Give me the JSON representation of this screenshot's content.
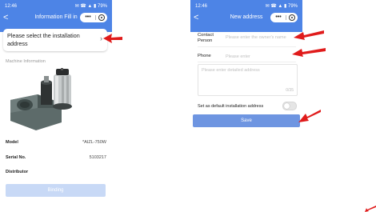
{
  "left": {
    "status": {
      "time": "12:46",
      "icons": "✉ ☎ ▲ ▮ 79%"
    },
    "header": {
      "back": "<",
      "title": "Information Fill in"
    },
    "install_prompt": "Please select the installation address",
    "section_title": "Machine Information",
    "details": [
      {
        "label": "Model",
        "value": "*AIZL-750W"
      },
      {
        "label": "Serial No.",
        "value": "5103217"
      },
      {
        "label": "Distributor",
        "value": ""
      }
    ],
    "bind_button": "Binding"
  },
  "right": {
    "status": {
      "time": "12:46",
      "icons": "✉ ☎ ▲ ▮ 79%"
    },
    "header": {
      "back": "<",
      "title": "New address"
    },
    "contact_label": "Contact Person",
    "contact_placeholder": "Please enter the owner's name",
    "phone_label": "Phone",
    "phone_placeholder": "Please enter",
    "address_placeholder": "Please enter detailed address",
    "address_count": "0/35",
    "default_label": "Set as default installation address",
    "save_button": "Save"
  },
  "colors": {
    "header": "#4d84e6",
    "save": "#6e95e1",
    "bind_disabled": "#c8d9f6",
    "arrow": "#e01b1b"
  }
}
